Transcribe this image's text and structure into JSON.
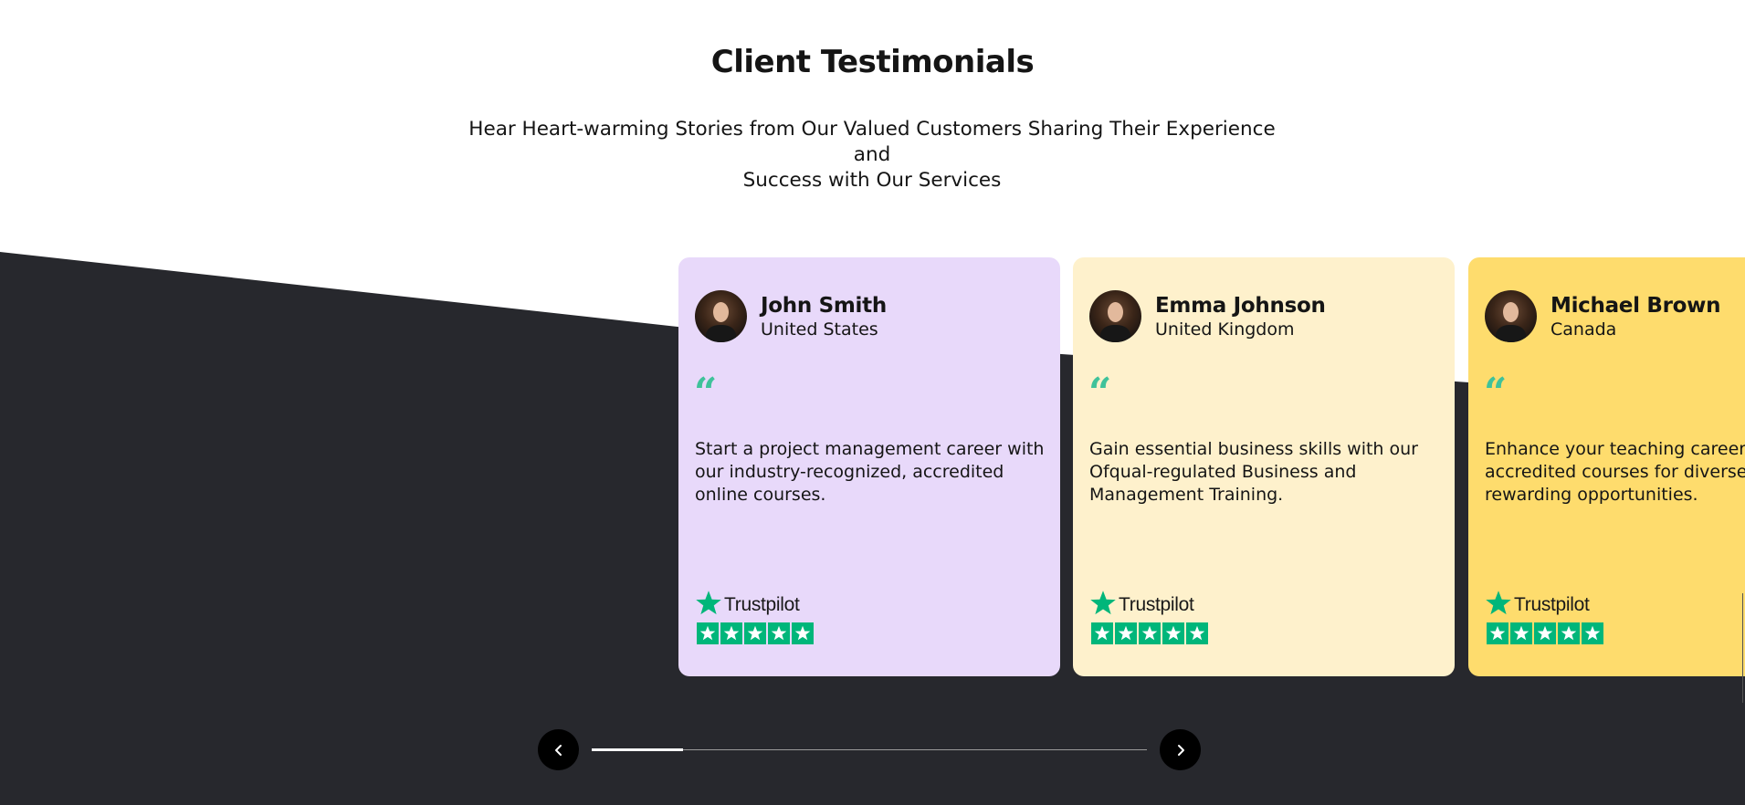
{
  "section": {
    "title": "Client Testimonials",
    "subtitle_line1": "Hear Heart-warming Stories from Our Valued Customers Sharing Their Experience and",
    "subtitle_line2": "Success with Our Services"
  },
  "colors": {
    "dark_background": "#27282d",
    "accent_green": "#3fc29a",
    "trustpilot_green": "#00b67a"
  },
  "testimonials": [
    {
      "name": "John Smith",
      "country": "United States",
      "avatar_icon": "avatar-photo",
      "quote_icon": "quote-icon",
      "text_lines": [
        "Start a project management career with",
        "our industry-recognized, accredited",
        "online courses."
      ],
      "rating_brand": "Trustpilot",
      "rating_stars": 5,
      "card_color": "#e8d9fa"
    },
    {
      "name": "Emma Johnson",
      "country": "United Kingdom",
      "avatar_icon": "avatar-photo",
      "quote_icon": "quote-icon",
      "text_lines": [
        "Gain essential business skills with our",
        "Ofqual-regulated Business and",
        "Management Training."
      ],
      "rating_brand": "Trustpilot",
      "rating_stars": 5,
      "card_color": "#fef1cc"
    },
    {
      "name": "Michael Brown",
      "country": "Canada",
      "avatar_icon": "avatar-photo",
      "quote_icon": "quote-icon",
      "text_lines": [
        "Enhance your teaching career v",
        "accredited courses for diverse",
        "rewarding opportunities."
      ],
      "rating_brand": "Trustpilot",
      "rating_stars": 5,
      "card_color": "#fedc6d"
    }
  ],
  "carousel": {
    "prev_icon": "chevron-left-icon",
    "next_icon": "chevron-right-icon",
    "progress": 0.165
  }
}
